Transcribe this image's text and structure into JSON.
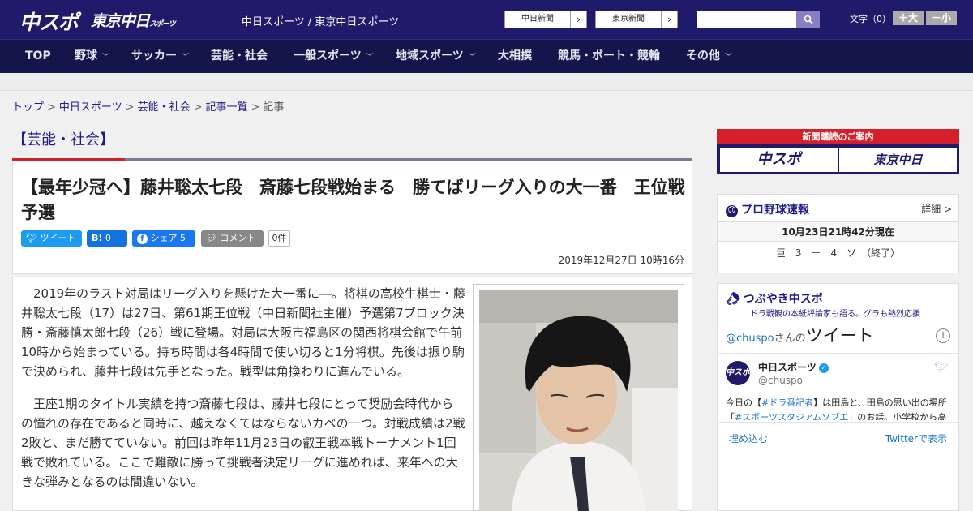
{
  "header": {
    "logo_chuspo": "中スポ",
    "logo_tokyo": "東京中日",
    "logo_tokyo_suffix": "スポーツ",
    "site_title": "中日スポーツ / 東京中日スポーツ",
    "ext_chunichi": "中日新聞",
    "ext_tokyo": "東京新聞",
    "search_placeholder": "",
    "font_size_label": "文字（0）",
    "font_larger": "＋大",
    "font_smaller": "－小",
    "accent_color": "#1f1a6a"
  },
  "nav": {
    "items": [
      {
        "label": "TOP",
        "dropdown": false
      },
      {
        "label": "野球",
        "dropdown": true
      },
      {
        "label": "サッカー",
        "dropdown": true
      },
      {
        "label": "芸能・社会",
        "dropdown": false
      },
      {
        "label": "一般スポーツ",
        "dropdown": true
      },
      {
        "label": "地域スポーツ",
        "dropdown": true
      },
      {
        "label": "大相撲",
        "dropdown": false
      },
      {
        "label": "競馬・ボート・競輪",
        "dropdown": false
      },
      {
        "label": "その他",
        "dropdown": true
      }
    ]
  },
  "breadcrumb": {
    "items": [
      "トップ",
      "中日スポーツ",
      "芸能・社会",
      "記事一覧"
    ],
    "current": "記事"
  },
  "article": {
    "category": "【芸能・社会】",
    "title": "【最年少冠へ】藤井聡太七段　斎藤七段戦始まる　勝てばリーグ入りの大一番　王位戦予選",
    "share": {
      "tweet": "ツイート",
      "hatena_count": "0",
      "facebook": "シェア",
      "facebook_count": "5",
      "comment": "コメント",
      "comment_count": "0件"
    },
    "date": "2019年12月27日 10時16分",
    "paragraphs": [
      "2019年のラスト対局はリーグ入りを懸けた大一番に―。将棋の高校生棋士・藤井聡太七段（17）は27日、第61期王位戦（中日新聞社主催）予選第7ブロック決勝・斎藤慎太郎七段（26）戦に登場。対局は大阪市福島区の関西将棋会館で午前10時から始まっている。持ち時間は各4時間で使い切ると1分将棋。先後は振り駒で決められ、藤井七段は先手となった。戦型は角換わりに進んでいる。",
      "王座1期のタイトル実績を持つ斎藤七段は、藤井七段にとって奨励会時代からの憧れの存在であると同時に、越えなくてはならないカベの一つ。対戦成績は2戦2敗と、まだ勝てていない。前回は昨年11月23日の叡王戦本戦トーナメント1回戦で敗れている。ここで難敵に勝って挑戦者決定リーグに進めれば、来年への大きな弾みとなるのは間違いない。"
    ]
  },
  "sidebar": {
    "subscribe": {
      "label": "新聞購読のご案内",
      "chuspo": "中スポ",
      "tokyo": "東京中日"
    },
    "baseball": {
      "title": "プロ野球速報",
      "detail": "詳細 >",
      "updated": "10月23日21時42分現在",
      "score": "巨　3　－　4　ソ　（終了）"
    },
    "tweets": {
      "title": "つぶやき中スポ",
      "subtitle": "ドラ戦観の本紙評論家も語る。グラも熱烈応援",
      "handle_prefix": "@chuspo",
      "handle_suffix": "さんの",
      "heading": "ツイート",
      "account_name": "中日スポーツ",
      "account_handle": "@chuspo",
      "avatar_text": "中スポ",
      "text_1": "今日の【",
      "hashtag_1": "#ドラ番記者",
      "text_2": "】は田島と、田島の思い出の場所「",
      "hashtag_2": "#スポーツスタジアムソブエ",
      "text_3": "」のお話。小学校から高校まで通っていたスポーツショップのようで、少年野球チーム時代のユニフォームも飾ってあ",
      "embed": "埋め込む",
      "view_on_twitter": "Twitterで表示"
    }
  }
}
